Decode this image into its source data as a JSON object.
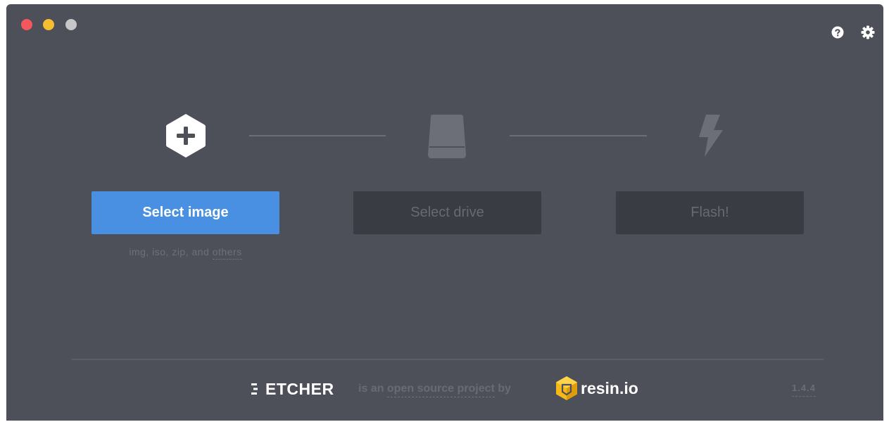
{
  "window": {
    "controls": {
      "close_color": "#f4575e",
      "minimize_color": "#f5bd30",
      "maximize_color": "#c7c7c7"
    },
    "top_icons": [
      "help-icon",
      "gear-icon"
    ]
  },
  "steps": {
    "image": {
      "icon": "plus-hexagon-icon",
      "button_label": "Select image",
      "hint_prefix": "img, iso, zip, and ",
      "hint_link": "others"
    },
    "drive": {
      "icon": "drive-icon",
      "button_label": "Select drive"
    },
    "flash": {
      "icon": "lightning-icon",
      "button_label": "Flash!"
    }
  },
  "footer": {
    "etcher_logo": "ETCHER",
    "tagline_prefix": "is an ",
    "tagline_link": "open source project",
    "tagline_suffix": " by",
    "company": "resin.io",
    "version": "1.4.4"
  },
  "colors": {
    "background": "#4d5059",
    "primary": "#4a90e2",
    "disabled_button": "#3a3c43"
  }
}
